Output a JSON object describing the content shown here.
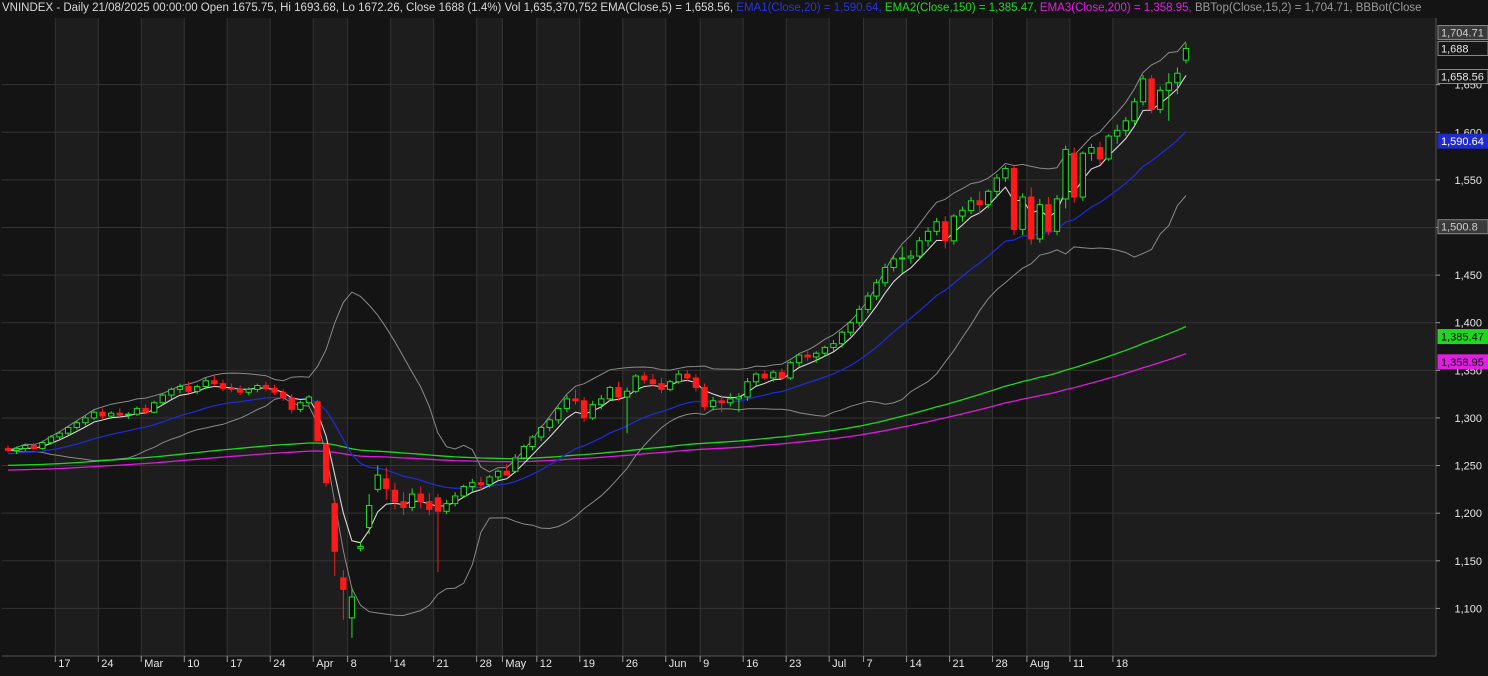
{
  "header": {
    "symbol_line": "VNINDEX - Daily 21/08/2025 00:00:00 Open 1675.75, Hi 1693.68, Lo 1672.26, Close 1688 (1.4%) Vol 1,635,370,752",
    "ema5": " EMA(Close,5) = 1,658.56,",
    "ema1": " EMA1(Close,20) = 1,590.64,",
    "ema2": " EMA2(Close,150) = 1,385.47,",
    "ema3": " EMA3(Close,200) = 1,358.95,",
    "bbtop": " BBTop(Close,15,2) = 1,704.71,",
    "bbbot": " BBBot(Close"
  },
  "colors": {
    "background": "#141414",
    "panel_alt": "#1d1d1d",
    "grid": "#333333",
    "axis_text": "#e6e6e6",
    "up": "#22e022",
    "down": "#ff1a1a",
    "ema5": "#d8d8d8",
    "ema20": "#1f2bd0",
    "ema150": "#1ed81e",
    "ema200": "#d81ed8",
    "bb": "#8a8a8a"
  },
  "chart_data": {
    "type": "candlestick",
    "y_range": [
      1050,
      1720
    ],
    "y_ticks": [
      {
        "value": 1100,
        "label": "1,100"
      },
      {
        "value": 1150,
        "label": "1,150"
      },
      {
        "value": 1200,
        "label": "1,200"
      },
      {
        "value": 1250,
        "label": "1,250"
      },
      {
        "value": 1300,
        "label": "1,300"
      },
      {
        "value": 1350,
        "label": "1,350"
      },
      {
        "value": 1400,
        "label": "1,400"
      },
      {
        "value": 1450,
        "label": "1,450"
      },
      {
        "value": 1500,
        "label": "1,500"
      },
      {
        "value": 1550,
        "label": "1,550"
      },
      {
        "value": 1600,
        "label": "1,600"
      },
      {
        "value": 1650,
        "label": "1,650"
      }
    ],
    "x_ticks": [
      {
        "index": 6,
        "label": "17"
      },
      {
        "index": 11,
        "label": "24"
      },
      {
        "index": 16,
        "label": "Mar"
      },
      {
        "index": 21,
        "label": "10"
      },
      {
        "index": 26,
        "label": "17"
      },
      {
        "index": 31,
        "label": "24"
      },
      {
        "index": 36,
        "label": "Apr"
      },
      {
        "index": 40,
        "label": "8"
      },
      {
        "index": 45,
        "label": "14"
      },
      {
        "index": 50,
        "label": "21"
      },
      {
        "index": 55,
        "label": "28"
      },
      {
        "index": 58,
        "label": "May"
      },
      {
        "index": 62,
        "label": "12"
      },
      {
        "index": 67,
        "label": "19"
      },
      {
        "index": 72,
        "label": "26"
      },
      {
        "index": 77,
        "label": "Jun"
      },
      {
        "index": 81,
        "label": "9"
      },
      {
        "index": 86,
        "label": "16"
      },
      {
        "index": 91,
        "label": "23"
      },
      {
        "index": 96,
        "label": "Jul"
      },
      {
        "index": 100,
        "label": "7"
      },
      {
        "index": 105,
        "label": "14"
      },
      {
        "index": 110,
        "label": "21"
      },
      {
        "index": 115,
        "label": "28"
      },
      {
        "index": 119,
        "label": "Aug"
      },
      {
        "index": 124,
        "label": "11"
      },
      {
        "index": 129,
        "label": "18"
      }
    ],
    "price_labels": [
      {
        "value": 1704.71,
        "label": "1,704.71",
        "series": "bbtop"
      },
      {
        "value": 1688,
        "label": "1,688",
        "series": "close"
      },
      {
        "value": 1658.56,
        "label": "1,658.56",
        "series": "ema5"
      },
      {
        "value": 1590.64,
        "label": "1,590.64",
        "series": "ema20"
      },
      {
        "value": 1500.8,
        "label": "1,500.8",
        "series": "bbbot"
      },
      {
        "value": 1385.47,
        "label": "1,385.47",
        "series": "ema150"
      },
      {
        "value": 1358.95,
        "label": "1,358.95",
        "series": "ema200"
      }
    ],
    "candles": [
      [
        1268,
        1271,
        1264,
        1266
      ],
      [
        1266,
        1270,
        1262,
        1268
      ],
      [
        1268,
        1273,
        1265,
        1271
      ],
      [
        1271,
        1274,
        1266,
        1268
      ],
      [
        1268,
        1276,
        1267,
        1274
      ],
      [
        1274,
        1282,
        1272,
        1280
      ],
      [
        1280,
        1286,
        1277,
        1284
      ],
      [
        1284,
        1292,
        1282,
        1290
      ],
      [
        1290,
        1297,
        1288,
        1295
      ],
      [
        1295,
        1302,
        1292,
        1300
      ],
      [
        1300,
        1308,
        1298,
        1306
      ],
      [
        1306,
        1310,
        1298,
        1302
      ],
      [
        1302,
        1307,
        1299,
        1305
      ],
      [
        1305,
        1310,
        1301,
        1303
      ],
      [
        1303,
        1306,
        1299,
        1304
      ],
      [
        1304,
        1312,
        1302,
        1310
      ],
      [
        1310,
        1314,
        1304,
        1306
      ],
      [
        1306,
        1318,
        1305,
        1316
      ],
      [
        1316,
        1326,
        1314,
        1324
      ],
      [
        1324,
        1332,
        1320,
        1330
      ],
      [
        1330,
        1336,
        1326,
        1333
      ],
      [
        1333,
        1338,
        1326,
        1328
      ],
      [
        1328,
        1335,
        1325,
        1333
      ],
      [
        1333,
        1342,
        1330,
        1339
      ],
      [
        1339,
        1344,
        1333,
        1336
      ],
      [
        1336,
        1340,
        1328,
        1331
      ],
      [
        1331,
        1336,
        1327,
        1330
      ],
      [
        1330,
        1334,
        1324,
        1327
      ],
      [
        1327,
        1332,
        1324,
        1330
      ],
      [
        1330,
        1336,
        1327,
        1334
      ],
      [
        1334,
        1338,
        1328,
        1331
      ],
      [
        1331,
        1335,
        1324,
        1327
      ],
      [
        1327,
        1330,
        1318,
        1321
      ],
      [
        1321,
        1325,
        1305,
        1309
      ],
      [
        1309,
        1318,
        1306,
        1316
      ],
      [
        1316,
        1324,
        1313,
        1322
      ],
      [
        1317,
        1319,
        1290,
        1276
      ],
      [
        1272,
        1274,
        1228,
        1232
      ],
      [
        1210,
        1214,
        1134,
        1160
      ],
      [
        1132,
        1140,
        1088,
        1120
      ],
      [
        1090,
        1122,
        1069,
        1112
      ],
      [
        1163,
        1170,
        1160,
        1165
      ],
      [
        1185,
        1220,
        1178,
        1208
      ],
      [
        1225,
        1250,
        1222,
        1240
      ],
      [
        1236,
        1248,
        1214,
        1226
      ],
      [
        1224,
        1232,
        1204,
        1212
      ],
      [
        1212,
        1222,
        1198,
        1206
      ],
      [
        1206,
        1226,
        1202,
        1220
      ],
      [
        1220,
        1228,
        1205,
        1212
      ],
      [
        1212,
        1221,
        1198,
        1204
      ],
      [
        1216,
        1220,
        1138,
        1202
      ],
      [
        1202,
        1214,
        1199,
        1210
      ],
      [
        1210,
        1222,
        1207,
        1218
      ],
      [
        1218,
        1230,
        1216,
        1228
      ],
      [
        1228,
        1236,
        1222,
        1232
      ],
      [
        1232,
        1238,
        1224,
        1230
      ],
      [
        1230,
        1240,
        1227,
        1238
      ],
      [
        1238,
        1246,
        1234,
        1244
      ],
      [
        1244,
        1252,
        1240,
        1240
      ],
      [
        1244,
        1262,
        1242,
        1258
      ],
      [
        1258,
        1272,
        1256,
        1270
      ],
      [
        1270,
        1282,
        1266,
        1280
      ],
      [
        1280,
        1292,
        1276,
        1290
      ],
      [
        1290,
        1300,
        1286,
        1298
      ],
      [
        1298,
        1312,
        1294,
        1310
      ],
      [
        1310,
        1324,
        1306,
        1320
      ],
      [
        1320,
        1330,
        1314,
        1318
      ],
      [
        1318,
        1322,
        1296,
        1300
      ],
      [
        1300,
        1318,
        1298,
        1314
      ],
      [
        1314,
        1324,
        1309,
        1320
      ],
      [
        1320,
        1334,
        1318,
        1332
      ],
      [
        1332,
        1338,
        1318,
        1322
      ],
      [
        1322,
        1332,
        1284,
        1328
      ],
      [
        1328,
        1346,
        1326,
        1344
      ],
      [
        1344,
        1348,
        1336,
        1340
      ],
      [
        1340,
        1346,
        1333,
        1336
      ],
      [
        1336,
        1342,
        1326,
        1330
      ],
      [
        1330,
        1340,
        1328,
        1338
      ],
      [
        1338,
        1350,
        1336,
        1346
      ],
      [
        1346,
        1350,
        1338,
        1342
      ],
      [
        1342,
        1346,
        1328,
        1332
      ],
      [
        1332,
        1336,
        1308,
        1312
      ],
      [
        1312,
        1322,
        1308,
        1318
      ],
      [
        1318,
        1324,
        1306,
        1316
      ],
      [
        1316,
        1326,
        1312,
        1320
      ],
      [
        1320,
        1326,
        1306,
        1322
      ],
      [
        1322,
        1342,
        1318,
        1338
      ],
      [
        1338,
        1348,
        1334,
        1346
      ],
      [
        1346,
        1350,
        1340,
        1342
      ],
      [
        1342,
        1350,
        1338,
        1348
      ],
      [
        1348,
        1352,
        1340,
        1342
      ],
      [
        1342,
        1360,
        1340,
        1358
      ],
      [
        1358,
        1368,
        1354,
        1366
      ],
      [
        1366,
        1370,
        1360,
        1364
      ],
      [
        1364,
        1370,
        1358,
        1368
      ],
      [
        1368,
        1376,
        1364,
        1374
      ],
      [
        1374,
        1382,
        1370,
        1378
      ],
      [
        1378,
        1392,
        1374,
        1390
      ],
      [
        1390,
        1402,
        1386,
        1400
      ],
      [
        1400,
        1418,
        1396,
        1414
      ],
      [
        1414,
        1432,
        1410,
        1428
      ],
      [
        1428,
        1446,
        1424,
        1442
      ],
      [
        1442,
        1462,
        1438,
        1458
      ],
      [
        1458,
        1470,
        1454,
        1467
      ],
      [
        1467,
        1480,
        1452,
        1468
      ],
      [
        1468,
        1476,
        1462,
        1470
      ],
      [
        1470,
        1490,
        1466,
        1486
      ],
      [
        1486,
        1500,
        1480,
        1496
      ],
      [
        1496,
        1510,
        1492,
        1506
      ],
      [
        1506,
        1512,
        1478,
        1486
      ],
      [
        1486,
        1514,
        1482,
        1512
      ],
      [
        1512,
        1522,
        1506,
        1518
      ],
      [
        1518,
        1532,
        1514,
        1528
      ],
      [
        1528,
        1538,
        1514,
        1524
      ],
      [
        1524,
        1540,
        1520,
        1538
      ],
      [
        1538,
        1556,
        1532,
        1552
      ],
      [
        1552,
        1565,
        1548,
        1562
      ],
      [
        1562,
        1566,
        1492,
        1498
      ],
      [
        1498,
        1536,
        1492,
        1532
      ],
      [
        1532,
        1542,
        1482,
        1488
      ],
      [
        1488,
        1530,
        1484,
        1524
      ],
      [
        1524,
        1532,
        1492,
        1496
      ],
      [
        1496,
        1534,
        1492,
        1530
      ],
      [
        1530,
        1586,
        1520,
        1582
      ],
      [
        1578,
        1584,
        1526,
        1532
      ],
      [
        1532,
        1580,
        1528,
        1578
      ],
      [
        1578,
        1588,
        1570,
        1584
      ],
      [
        1584,
        1590,
        1566,
        1572
      ],
      [
        1572,
        1598,
        1570,
        1596
      ],
      [
        1596,
        1608,
        1588,
        1602
      ],
      [
        1602,
        1616,
        1596,
        1612
      ],
      [
        1612,
        1636,
        1608,
        1632
      ],
      [
        1632,
        1660,
        1628,
        1656
      ],
      [
        1656,
        1660,
        1620,
        1624
      ],
      [
        1624,
        1648,
        1620,
        1644
      ],
      [
        1644,
        1662,
        1612,
        1652
      ],
      [
        1652,
        1668,
        1640,
        1662
      ],
      [
        1675.75,
        1693.68,
        1672.26,
        1688
      ]
    ]
  }
}
